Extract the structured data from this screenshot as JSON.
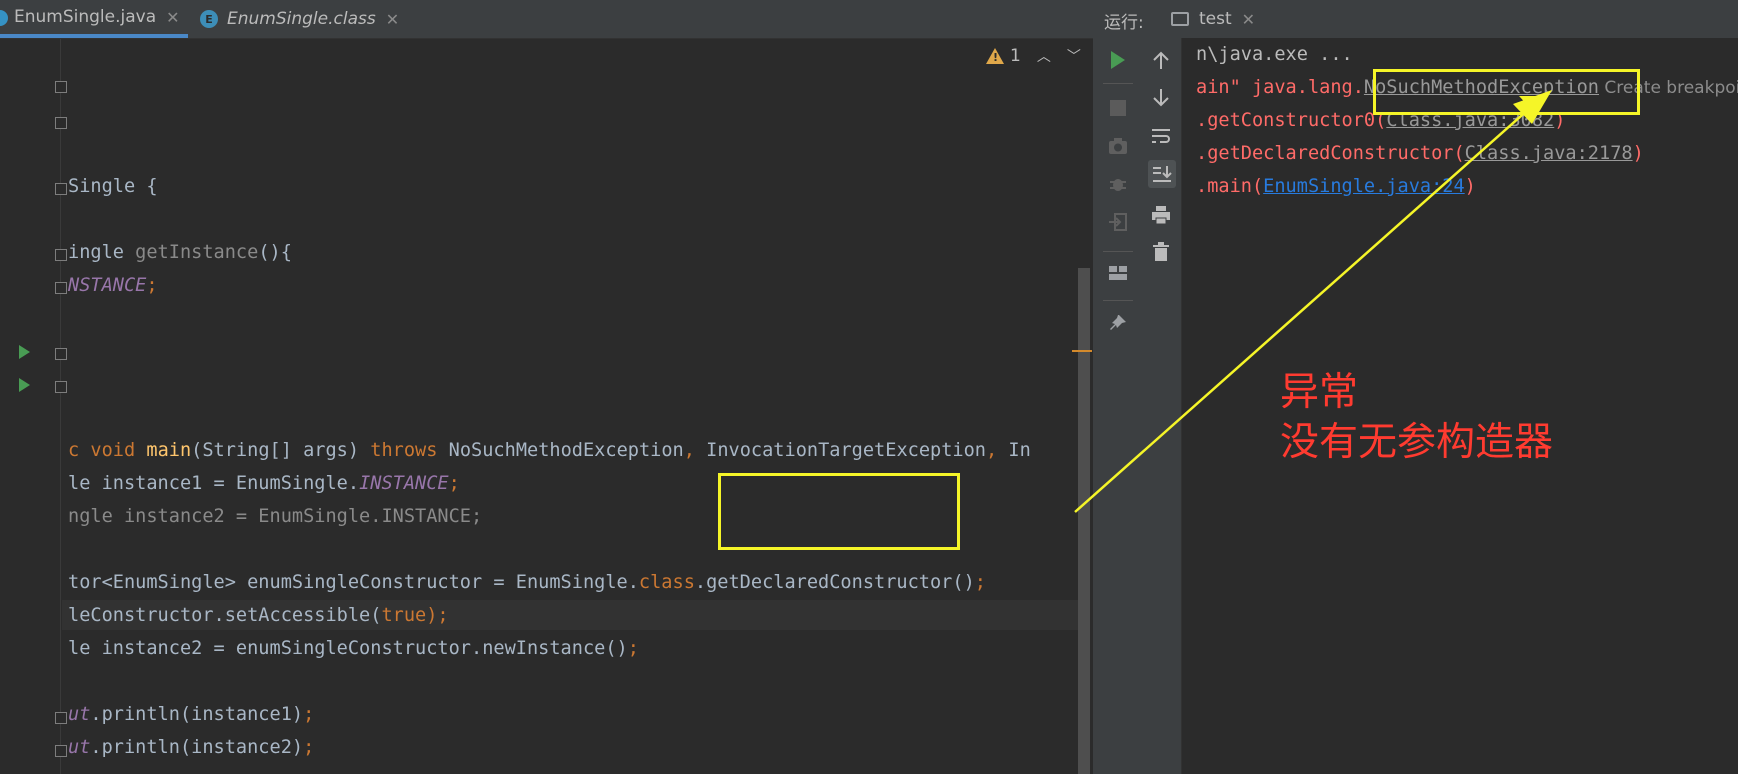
{
  "editor": {
    "tabs": [
      {
        "label": "EnumSingle.java",
        "active": true
      },
      {
        "label": "EnumSingle.class",
        "active": false,
        "badge": "E"
      }
    ],
    "inspection_count": "1",
    "lines": [
      {
        "row": 2,
        "segments": [
          {
            "t": "Single {",
            "c": "plain"
          }
        ]
      },
      {
        "row": 4,
        "segments": [
          {
            "t": "ingle ",
            "c": "plain"
          },
          {
            "t": "getInstance",
            "c": "faded"
          },
          {
            "t": "(){",
            "c": "plain"
          }
        ]
      },
      {
        "row": 5,
        "segments": [
          {
            "t": "NSTANCE",
            "c": "field"
          },
          {
            "t": ";",
            "c": "kw"
          }
        ]
      },
      {
        "row": 10,
        "segments": [
          {
            "t": "c ",
            "c": "kw"
          },
          {
            "t": "void ",
            "c": "kw"
          },
          {
            "t": "main",
            "c": "fn"
          },
          {
            "t": "(String[] args) ",
            "c": "plain"
          },
          {
            "t": "throws ",
            "c": "kw"
          },
          {
            "t": "NoSuchMethodException",
            "c": "plain"
          },
          {
            "t": ", ",
            "c": "kw"
          },
          {
            "t": "InvocationTargetException",
            "c": "plain"
          },
          {
            "t": ", ",
            "c": "kw"
          },
          {
            "t": "In",
            "c": "plain"
          }
        ]
      },
      {
        "row": 11,
        "segments": [
          {
            "t": "le instance1 = EnumSingle.",
            "c": "plain"
          },
          {
            "t": "INSTANCE",
            "c": "field"
          },
          {
            "t": ";",
            "c": "kw"
          }
        ]
      },
      {
        "row": 12,
        "segments": [
          {
            "t": "ngle instance2 = EnumSingle.INSTANCE;",
            "c": "faded"
          }
        ]
      },
      {
        "row": 14,
        "segments": [
          {
            "t": "tor<EnumSingle> enumSingleConstructor = EnumSingle.",
            "c": "plain"
          },
          {
            "t": "class",
            "c": "kw"
          },
          {
            "t": ".getDeclaredConstructor()",
            "c": "plain"
          },
          {
            "t": ";",
            "c": "kw"
          }
        ]
      },
      {
        "row": 15,
        "segments": [
          {
            "t": "leConstructor.setAccessible(",
            "c": "plain"
          },
          {
            "t": "true",
            "c": "kw"
          },
          {
            "t": ");",
            "c": "kw"
          }
        ]
      },
      {
        "row": 16,
        "segments": [
          {
            "t": "le instance2 = enumSingleConstructor.newInstance()",
            "c": "plain"
          },
          {
            "t": ";",
            "c": "kw"
          }
        ]
      },
      {
        "row": 18,
        "segments": [
          {
            "t": "ut",
            "c": "field"
          },
          {
            "t": ".println(instance1)",
            "c": "plain"
          },
          {
            "t": ";",
            "c": "kw"
          }
        ]
      },
      {
        "row": 19,
        "segments": [
          {
            "t": "ut",
            "c": "field"
          },
          {
            "t": ".println(instance2)",
            "c": "plain"
          },
          {
            "t": ";",
            "c": "kw"
          }
        ]
      }
    ]
  },
  "run_panel": {
    "title": "运行:",
    "tab_label": "test",
    "console": [
      {
        "row": 0,
        "segments": [
          {
            "t": "n\\java.exe ...",
            "c": "gray-text"
          }
        ]
      },
      {
        "row": 1,
        "segments": [
          {
            "t": "ain\" java.lang.",
            "c": "err"
          },
          {
            "t": "NoSuchMethodException",
            "c": "exc-link"
          },
          {
            "t": " Create breakpoint",
            "c": "create-break"
          }
        ]
      },
      {
        "row": 2,
        "segments": [
          {
            "t": ".getConstructor0(",
            "c": "err"
          },
          {
            "t": "Class.java:3082",
            "c": "gray-link"
          },
          {
            "t": ")",
            "c": "err"
          }
        ]
      },
      {
        "row": 3,
        "segments": [
          {
            "t": ".getDeclaredConstructor(",
            "c": "err"
          },
          {
            "t": "Class.java:2178",
            "c": "gray-link"
          },
          {
            "t": ")",
            "c": "err"
          }
        ]
      },
      {
        "row": 4,
        "segments": [
          {
            "t": ".main(",
            "c": "err"
          },
          {
            "t": "EnumSingle.java:24",
            "c": "blue-link"
          },
          {
            "t": ")",
            "c": "err"
          }
        ]
      }
    ]
  },
  "annotation": {
    "line1": "异常",
    "line2": "没有无参构造器",
    "highlight_color": "#f5f528",
    "text_color": "#ff3b30"
  }
}
